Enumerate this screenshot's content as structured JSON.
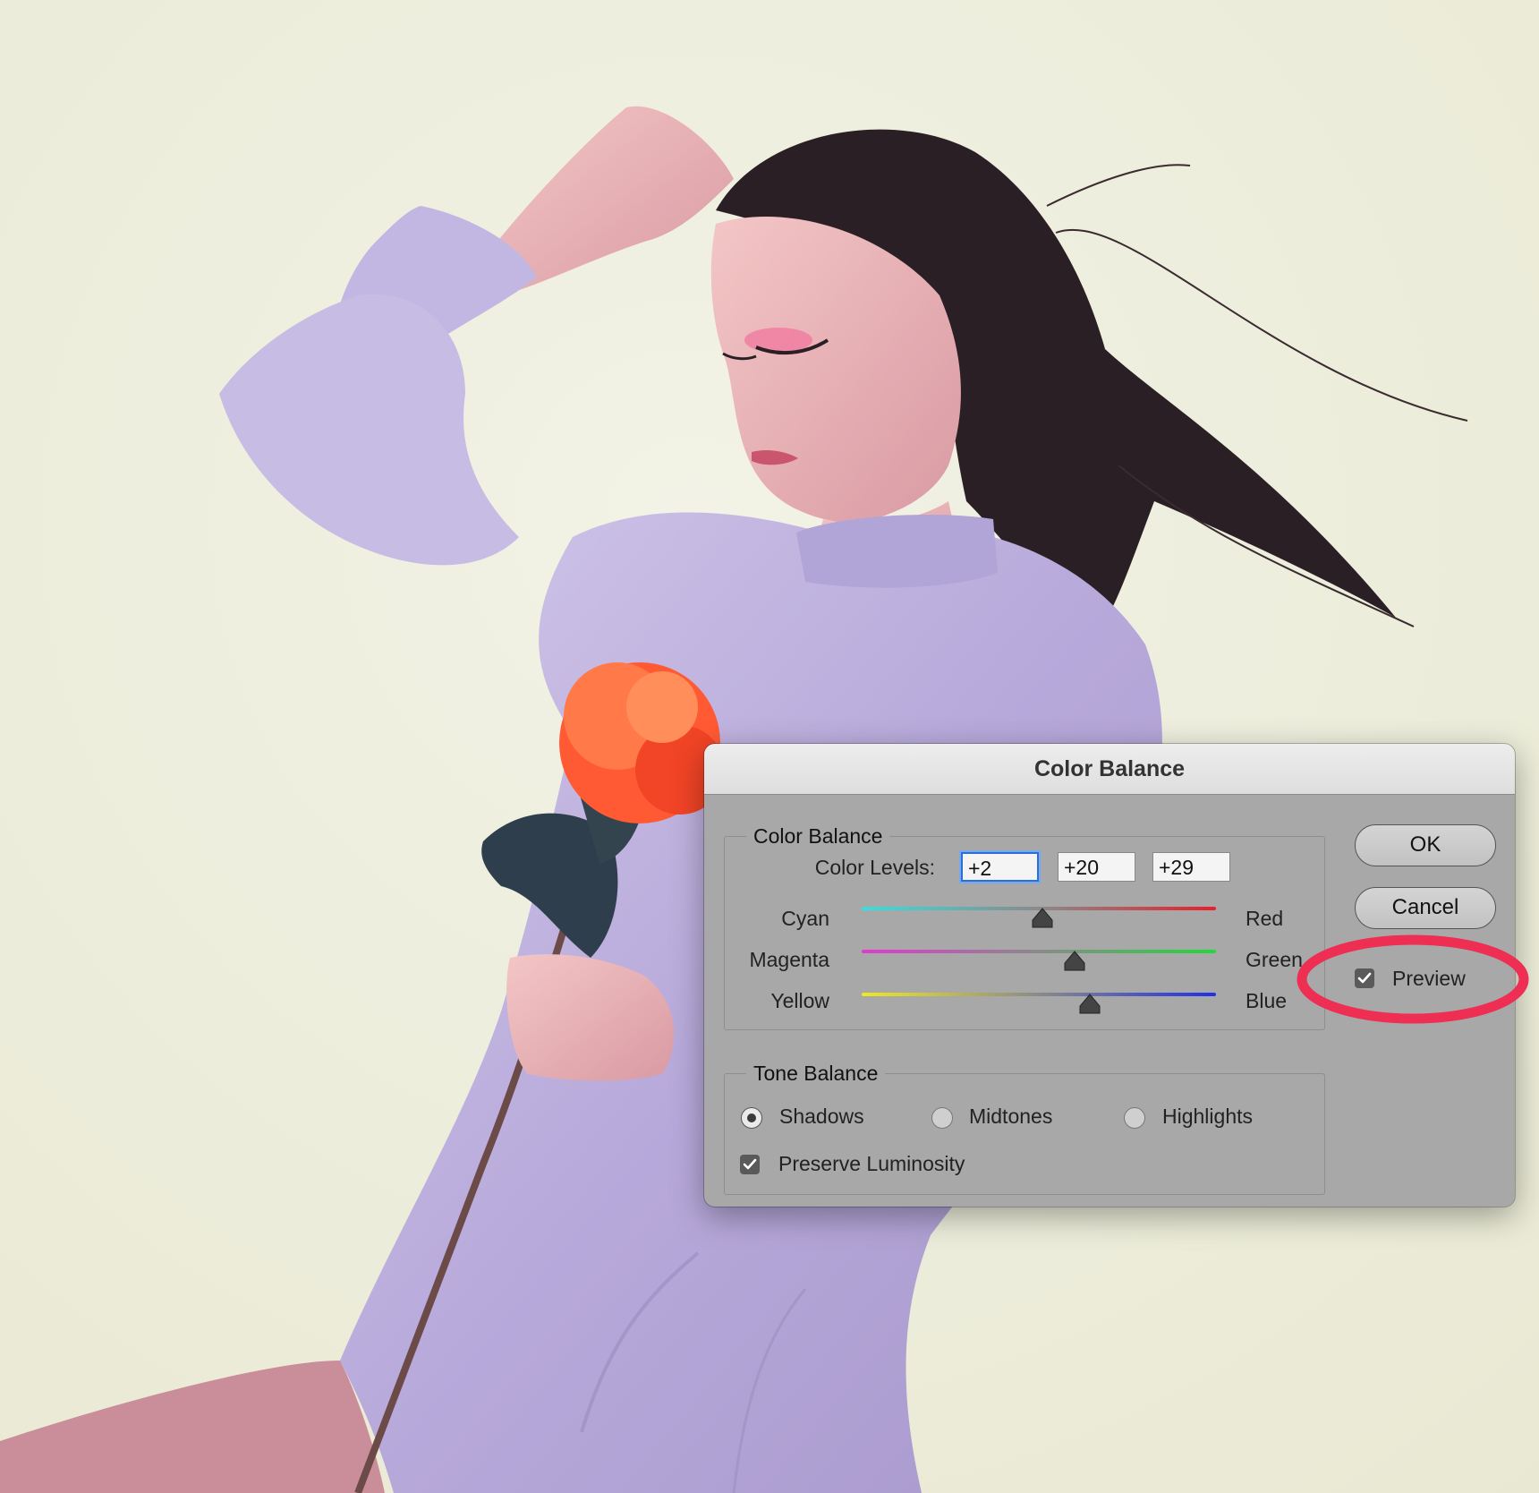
{
  "dialog": {
    "title": "Color Balance",
    "color_balance_group": {
      "legend": "Color Balance",
      "color_levels_label": "Color Levels:",
      "levels": [
        "+2",
        "+20",
        "+29"
      ],
      "sliders": [
        {
          "left": "Cyan",
          "right": "Red",
          "value": 2,
          "gradient": [
            "#35e0e0",
            "#e8202a"
          ]
        },
        {
          "left": "Magenta",
          "right": "Green",
          "value": 20,
          "gradient": [
            "#e03ad0",
            "#20d83a"
          ]
        },
        {
          "left": "Yellow",
          "right": "Blue",
          "value": 29,
          "gradient": [
            "#f0e820",
            "#2030e8"
          ]
        }
      ],
      "slider_range": [
        -100,
        100
      ]
    },
    "tone_balance_group": {
      "legend": "Tone Balance",
      "options": [
        {
          "label": "Shadows",
          "selected": true
        },
        {
          "label": "Midtones",
          "selected": false
        },
        {
          "label": "Highlights",
          "selected": false
        }
      ],
      "preserve_luminosity": {
        "label": "Preserve Luminosity",
        "checked": true
      }
    },
    "buttons": {
      "ok": "OK",
      "cancel": "Cancel"
    },
    "preview": {
      "label": "Preview",
      "checked": true
    }
  },
  "annotation": {
    "color": "#ee2e52",
    "target": "preview-checkbox"
  }
}
